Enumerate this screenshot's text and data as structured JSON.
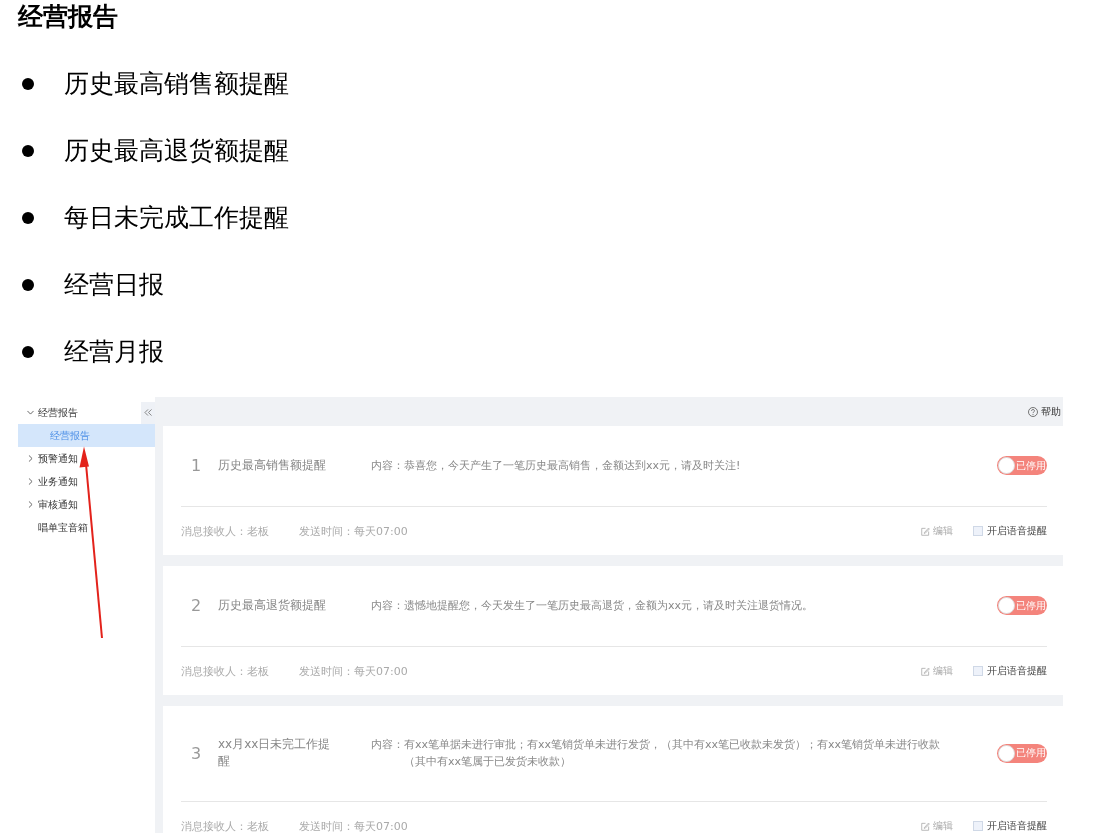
{
  "slide": {
    "title": "经营报告",
    "bullets": [
      "历史最高销售额提醒",
      "历史最高退货额提醒",
      "每日未完成工作提醒",
      "经营日报",
      "经营月报"
    ]
  },
  "app": {
    "help": "帮助",
    "sidebar": {
      "items": [
        {
          "kind": "group",
          "label": "经营报告",
          "expanded": true,
          "selected": false,
          "children": [
            {
              "label": "经营报告",
              "selected": true
            }
          ]
        },
        {
          "kind": "group",
          "label": "预警通知",
          "expanded": false,
          "selected": false
        },
        {
          "kind": "group",
          "label": "业务通知",
          "expanded": false,
          "selected": false
        },
        {
          "kind": "group",
          "label": "审核通知",
          "expanded": false,
          "selected": false
        },
        {
          "kind": "leaf",
          "label": "唱单宝音箱",
          "selected": false
        }
      ]
    },
    "cards": [
      {
        "index": "1",
        "title": "历史最高销售额提醒",
        "content_label": "内容：",
        "content": "恭喜您，今天产生了一笔历史最高销售，金额达到xx元，请及时关注!",
        "toggle": {
          "on": false,
          "label": "已停用"
        },
        "receiver": "消息接收人：老板",
        "send_time": "发送时间：每天07:00",
        "edit": "编辑",
        "voice": {
          "label": "开启语音提醒",
          "checked": false
        }
      },
      {
        "index": "2",
        "title": "历史最高退货额提醒",
        "content_label": "内容：",
        "content": "遗憾地提醒您，今天发生了一笔历史最高退货，金额为xx元，请及时关注退货情况。",
        "toggle": {
          "on": false,
          "label": "已停用"
        },
        "receiver": "消息接收人：老板",
        "send_time": "发送时间：每天07:00",
        "edit": "编辑",
        "voice": {
          "label": "开启语音提醒",
          "checked": false
        }
      },
      {
        "index": "3",
        "title": "xx月xx日未完工作提醒",
        "content_label": "内容：",
        "content": "有xx笔单据未进行审批；有xx笔销货单未进行发货，（其中有xx笔已收款未发货）；有xx笔销货单未进行收款（其中有xx笔属于已发货未收款）",
        "toggle": {
          "on": false,
          "label": "已停用"
        },
        "receiver": "消息接收人：老板",
        "send_time": "发送时间：每天07:00",
        "edit": "编辑",
        "voice": {
          "label": "开启语音提醒",
          "checked": false
        }
      }
    ]
  }
}
